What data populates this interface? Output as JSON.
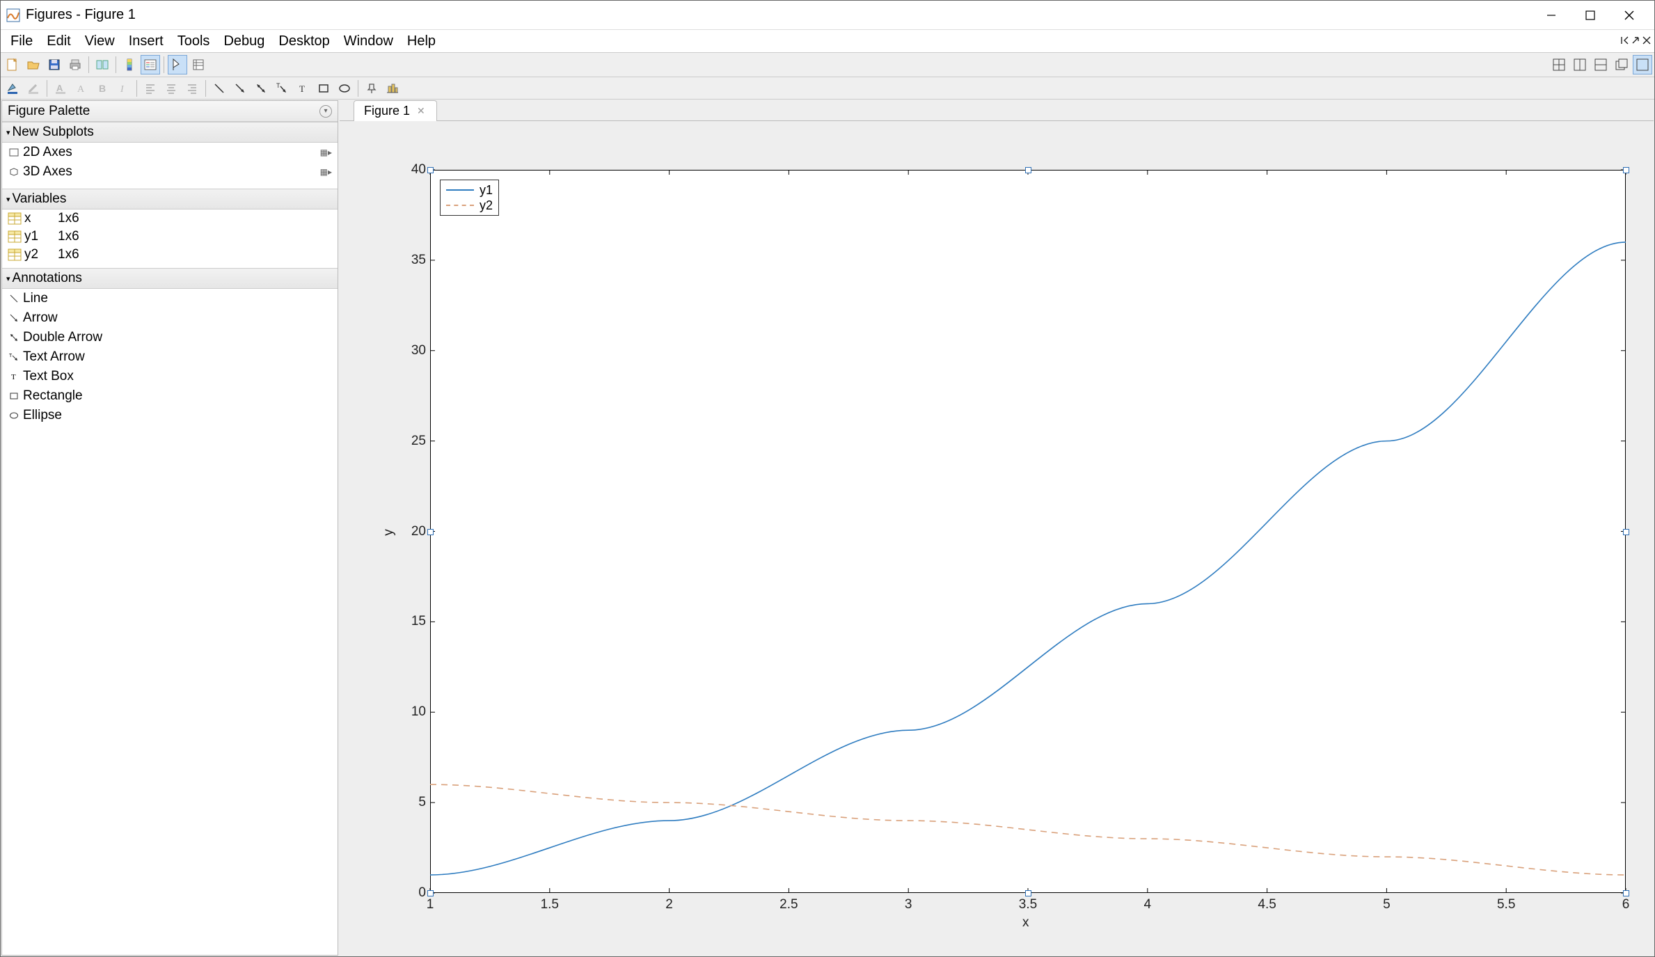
{
  "window": {
    "title": "Figures - Figure 1"
  },
  "menu": {
    "items": [
      "File",
      "Edit",
      "View",
      "Insert",
      "Tools",
      "Debug",
      "Desktop",
      "Window",
      "Help"
    ]
  },
  "palette": {
    "title": "Figure Palette",
    "sections": {
      "new_subplots": {
        "title": "New Subplots",
        "axes2d": "2D Axes",
        "axes3d": "3D Axes"
      },
      "variables": {
        "title": "Variables",
        "rows": [
          {
            "name": "x",
            "size": "1x6"
          },
          {
            "name": "y1",
            "size": "1x6"
          },
          {
            "name": "y2",
            "size": "1x6"
          }
        ]
      },
      "annotations": {
        "title": "Annotations",
        "items": [
          "Line",
          "Arrow",
          "Double Arrow",
          "Text Arrow",
          "Text Box",
          "Rectangle",
          "Ellipse"
        ]
      }
    }
  },
  "tab": {
    "label": "Figure 1"
  },
  "chart_data": {
    "type": "line",
    "x": [
      1,
      2,
      3,
      4,
      5,
      6
    ],
    "series": [
      {
        "name": "y1",
        "values": [
          1,
          4,
          9,
          16,
          25,
          36
        ],
        "color": "#2e7cc0",
        "dash": "solid"
      },
      {
        "name": "y2",
        "values": [
          6,
          5,
          4,
          3,
          2,
          1
        ],
        "color": "#d9a07a",
        "dash": "dashed"
      }
    ],
    "xlabel": "x",
    "ylabel": "y",
    "xlim": [
      1,
      6
    ],
    "ylim": [
      0,
      40
    ],
    "xticks": [
      1,
      1.5,
      2,
      2.5,
      3,
      3.5,
      4,
      4.5,
      5,
      5.5,
      6
    ],
    "yticks": [
      0,
      5,
      10,
      15,
      20,
      25,
      30,
      35,
      40
    ],
    "legend_position": "upper-left"
  }
}
